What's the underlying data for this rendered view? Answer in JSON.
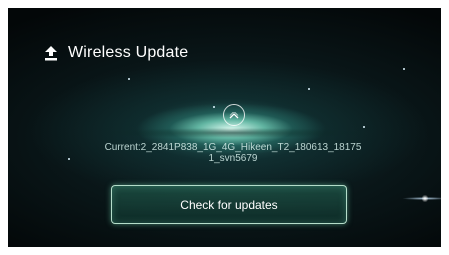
{
  "header": {
    "icon": "upload-icon",
    "title": "Wireless Update"
  },
  "scroll_up": {
    "icon": "chevron-up-icon"
  },
  "firmware": {
    "current": "Current:2_2841P838_1G_4G_Hikeen_T2_180613_18175\n1_svn5679"
  },
  "actions": {
    "check_label": "Check for updates"
  },
  "colors": {
    "background": "#030708",
    "glow": "#78d7be",
    "button_border": "#c8f0dc",
    "text": "#ffffff"
  }
}
